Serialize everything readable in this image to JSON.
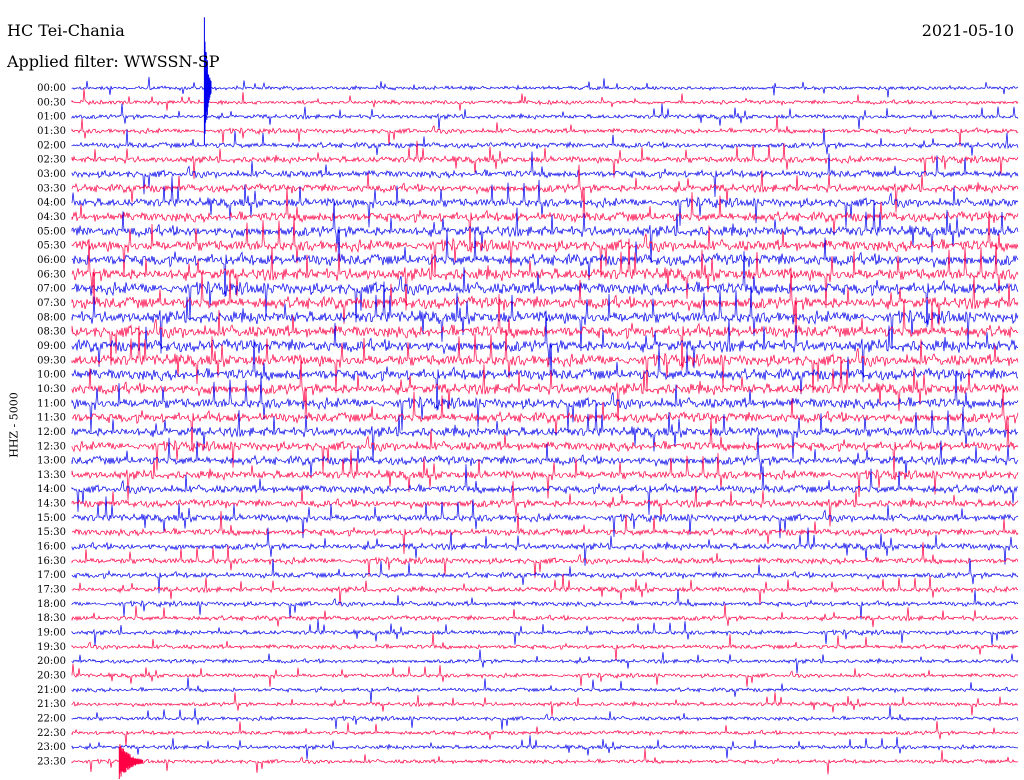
{
  "header": {
    "station": "HC Tei-Chania",
    "date": "2021-05-10",
    "filter": "Applied filter: WWSSN-SP",
    "channel": "HHZ - 5000"
  },
  "chart_data": {
    "type": "line",
    "title": "HC Tei-Chania",
    "xlabel": "",
    "ylabel": "HHZ - 5000",
    "row_labels": [
      "00:00",
      "00:30",
      "01:00",
      "01:30",
      "02:00",
      "02:30",
      "03:00",
      "03:30",
      "04:00",
      "04:30",
      "05:00",
      "05:30",
      "06:00",
      "06:30",
      "07:00",
      "07:30",
      "08:00",
      "08:30",
      "09:00",
      "09:30",
      "10:00",
      "10:30",
      "11:00",
      "11:30",
      "12:00",
      "12:30",
      "13:00",
      "13:30",
      "14:00",
      "14:30",
      "15:00",
      "15:30",
      "16:00",
      "16:30",
      "17:00",
      "17:30",
      "18:00",
      "18:30",
      "19:00",
      "19:30",
      "20:00",
      "20:30",
      "21:00",
      "21:30",
      "22:00",
      "22:30",
      "23:00",
      "23:30"
    ],
    "colors": [
      "#0000ee",
      "#ff0044"
    ],
    "noise_amplitude": [
      0.45,
      0.5,
      0.55,
      0.6,
      0.7,
      0.8,
      0.9,
      1.0,
      1.1,
      1.2,
      1.3,
      1.4,
      1.45,
      1.5,
      1.5,
      1.5,
      1.5,
      1.5,
      1.5,
      1.45,
      1.4,
      1.35,
      1.3,
      1.25,
      1.2,
      1.15,
      1.1,
      1.05,
      1.0,
      0.95,
      0.9,
      0.85,
      0.8,
      0.75,
      0.7,
      0.65,
      0.6,
      0.6,
      0.55,
      0.55,
      0.5,
      0.5,
      0.5,
      0.5,
      0.5,
      0.5,
      0.5,
      0.5
    ],
    "major_events": [
      {
        "row": 0,
        "time_fraction": 0.14
      },
      {
        "row": 47,
        "time_fraction": 0.05
      }
    ]
  }
}
